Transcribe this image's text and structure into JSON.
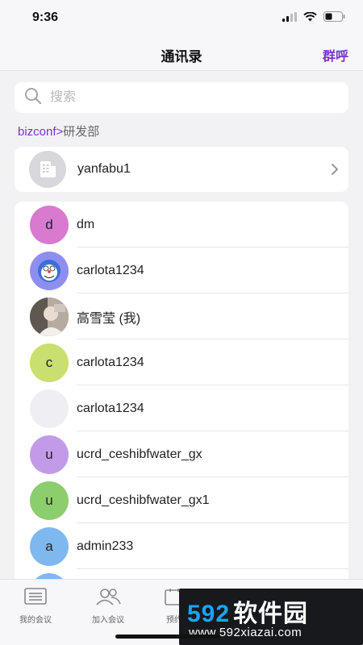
{
  "status_bar": {
    "time": "9:36"
  },
  "nav": {
    "title": "通讯录",
    "action": "群呼"
  },
  "search": {
    "placeholder": "搜索"
  },
  "breadcrumb": {
    "root": "bizconf",
    "separator": ">",
    "current": "研发部"
  },
  "department": {
    "name": "yanfabu1"
  },
  "contacts": [
    {
      "name": "dm",
      "initial": "d",
      "color": "#d77ad0",
      "kind": "letter"
    },
    {
      "name": "carlota1234",
      "initial": "",
      "color": "#8e8ef0",
      "kind": "cartoon"
    },
    {
      "name": "高雪莹 (我)",
      "initial": "",
      "color": "#9a8f85",
      "kind": "photo"
    },
    {
      "name": "carlota1234",
      "initial": "c",
      "color": "#c9df6f",
      "kind": "letter"
    },
    {
      "name": "carlota1234",
      "initial": "",
      "color": "#efeff3",
      "kind": "blank"
    },
    {
      "name": "ucrd_ceshibfwater_gx",
      "initial": "u",
      "color": "#c19be8",
      "kind": "letter"
    },
    {
      "name": "ucrd_ceshibfwater_gx1",
      "initial": "u",
      "color": "#8ccd6e",
      "kind": "letter"
    },
    {
      "name": "admin233",
      "initial": "a",
      "color": "#7fb8ef",
      "kind": "letter"
    }
  ],
  "tabs": [
    {
      "label": "我的会议",
      "icon": "meeting-list-icon"
    },
    {
      "label": "加入会议",
      "icon": "join-meeting-icon"
    },
    {
      "label": "预约",
      "icon": "schedule-icon"
    }
  ],
  "watermark": {
    "brand_number": "592",
    "brand_cn": "软件园",
    "site": "www.592xiazai.com"
  },
  "accent_color": "#7b35c8"
}
